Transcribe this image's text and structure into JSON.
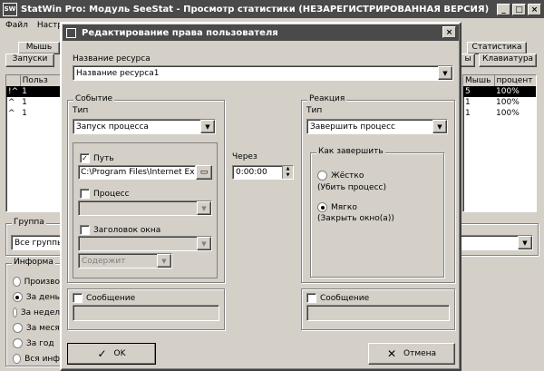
{
  "main_window": {
    "title": "StatWin Pro: Модуль SeeStat - Просмотр статистики (НЕЗАРЕГИСТРИРОВАННАЯ ВЕРСИЯ)",
    "icon_text": "SW",
    "menu": [
      "Файл",
      "Настро"
    ],
    "tabs_row1_left": "Мышь",
    "tabs_row2_left": "Запуски",
    "tabs_row1_right": "Статистика",
    "tabs_row2_right_partial": "ы",
    "tabs_row2_right": "Клавиатура",
    "table_left_header": "Польз",
    "table_left_rows": [
      {
        "mark": "!^",
        "value": "1"
      },
      {
        "mark": "^",
        "value": "1"
      },
      {
        "mark": "^",
        "value": "1"
      }
    ],
    "table_right_headers": [
      "Мышь",
      "процент"
    ],
    "table_right_rows": [
      [
        "5",
        "100%"
      ],
      [
        "1",
        "100%"
      ],
      [
        "1",
        "100%"
      ]
    ],
    "group_label": "Группа",
    "group_value": "Все группы",
    "info_label": "Информа",
    "info_options": [
      "Произво",
      "За день",
      "За недел",
      "За меся",
      "За год",
      "Вся инф"
    ],
    "info_selected": 1
  },
  "dialog": {
    "title": "Редактирование права пользователя",
    "resource_label": "Название ресурса",
    "resource_value": "Название ресурса1",
    "event": {
      "group_label": "Событие",
      "type_label": "Тип",
      "type_value": "Запуск процесса",
      "path_label": "Путь",
      "path_checked": true,
      "path_value": "C:\\Program Files\\Internet Explore",
      "process_label": "Процесс",
      "window_title_label": "Заголовок окна",
      "contains_value": "Содержит"
    },
    "after_label": "Через",
    "after_value": "0:00:00",
    "reaction": {
      "group_label": "Реакция",
      "type_label": "Тип",
      "type_value": "Завершить процесс",
      "how_label": "Как завершить",
      "hard_label": "Жёстко",
      "hard_desc": "(Убить процесс)",
      "soft_label": "Мягко",
      "soft_desc": "(Закрыть окно(а))",
      "selected": "soft"
    },
    "message_left_label": "Сообщение",
    "message_right_label": "Сообщение",
    "ok_label": "OK",
    "cancel_label": "Отмена"
  }
}
